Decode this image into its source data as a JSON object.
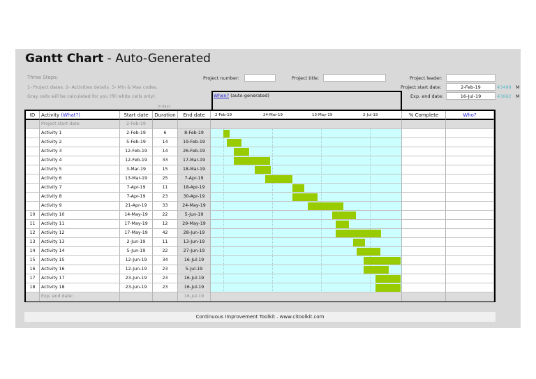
{
  "header": {
    "title_bold": "Gantt Chart",
    "title_rest": " - Auto-Generated",
    "three_steps": "Three Steps:",
    "steps": "1- Project dates.   2- Activities details.   3- Min & Max codes.",
    "note": "Gray cells will be calculated for you (fill white cells only).",
    "project_number_label": "Project number:",
    "project_title_label": "Project title:",
    "project_leader_label": "Project leader:",
    "project_start_label": "Project start date:",
    "project_start_value": "2-Feb-19",
    "project_start_serial": "43498",
    "exp_end_label": "Exp. end date:",
    "exp_end_value": "16-Jul-19",
    "exp_end_serial": "43662",
    "serial_suffix": "M",
    "in_days": "In days",
    "when_label": "When?",
    "when_rest": " (auto-generated)"
  },
  "table": {
    "col_id": "ID",
    "col_activity": "Activity ",
    "col_activity_link": "(What?)",
    "col_start": "Start date",
    "col_duration": "Duration",
    "col_end": "End date",
    "col_complete": "% Complete",
    "col_who": "Who?",
    "start_row_label": "Project start date:",
    "start_row_value": "2-Feb-19",
    "end_row_label": "Exp. end date:",
    "end_row_value": "16-Jul-19",
    "timeline_ticks": [
      "2-Feb-19",
      "24-Mar-19",
      "13-May-19",
      "2-Jul-19"
    ],
    "rows": [
      {
        "id": "",
        "activity": "Activity 1",
        "start": "2-Feb-19",
        "duration": "6",
        "end": "8-Feb-19",
        "s": 0,
        "d": 6
      },
      {
        "id": "",
        "activity": "Activity 2",
        "start": "5-Feb-19",
        "duration": "14",
        "end": "19-Feb-19",
        "s": 3,
        "d": 14
      },
      {
        "id": "",
        "activity": "Activity 3",
        "start": "12-Feb-19",
        "duration": "14",
        "end": "26-Feb-19",
        "s": 10,
        "d": 14
      },
      {
        "id": "",
        "activity": "Activity 4",
        "start": "12-Feb-19",
        "duration": "33",
        "end": "17-Mar-19",
        "s": 10,
        "d": 33
      },
      {
        "id": "",
        "activity": "Activity 5",
        "start": "3-Mar-19",
        "duration": "15",
        "end": "18-Mar-19",
        "s": 29,
        "d": 15
      },
      {
        "id": "",
        "activity": "Activity 6",
        "start": "13-Mar-19",
        "duration": "25",
        "end": "7-Apr-19",
        "s": 39,
        "d": 25
      },
      {
        "id": "",
        "activity": "Activity 7",
        "start": "7-Apr-19",
        "duration": "11",
        "end": "18-Apr-19",
        "s": 64,
        "d": 11
      },
      {
        "id": "",
        "activity": "Activity 8",
        "start": "7-Apr-19",
        "duration": "23",
        "end": "30-Apr-19",
        "s": 64,
        "d": 23
      },
      {
        "id": "",
        "activity": "Activity 9",
        "start": "21-Apr-19",
        "duration": "33",
        "end": "24-May-19",
        "s": 78,
        "d": 33
      },
      {
        "id": "10",
        "activity": "Activity 10",
        "start": "14-May-19",
        "duration": "22",
        "end": "5-Jun-19",
        "s": 101,
        "d": 22
      },
      {
        "id": "11",
        "activity": "Activity 11",
        "start": "17-May-19",
        "duration": "12",
        "end": "29-May-19",
        "s": 104,
        "d": 12
      },
      {
        "id": "12",
        "activity": "Activity 12",
        "start": "17-May-19",
        "duration": "42",
        "end": "28-Jun-19",
        "s": 104,
        "d": 42
      },
      {
        "id": "13",
        "activity": "Activity 13",
        "start": "2-Jun-19",
        "duration": "11",
        "end": "13-Jun-19",
        "s": 120,
        "d": 11
      },
      {
        "id": "14",
        "activity": "Activity 14",
        "start": "5-Jun-19",
        "duration": "22",
        "end": "27-Jun-19",
        "s": 123,
        "d": 22
      },
      {
        "id": "15",
        "activity": "Activity 15",
        "start": "12-Jun-19",
        "duration": "34",
        "end": "16-Jul-19",
        "s": 130,
        "d": 34
      },
      {
        "id": "16",
        "activity": "Activity 16",
        "start": "12-Jun-19",
        "duration": "23",
        "end": "5-Jul-19",
        "s": 130,
        "d": 23
      },
      {
        "id": "17",
        "activity": "Activity 17",
        "start": "23-Jun-19",
        "duration": "23",
        "end": "16-Jul-19",
        "s": 141,
        "d": 23
      },
      {
        "id": "18",
        "activity": "Activity 18",
        "start": "23-Jun-19",
        "duration": "23",
        "end": "16-Jul-19",
        "s": 141,
        "d": 23
      }
    ]
  },
  "colors": {
    "bar": "#99cc00",
    "timeline_bg": "#ccffff",
    "link": "#1f1fd6",
    "serial": "#5bb8c8"
  },
  "footer": "Continuous Improvement Toolkit . www.citoolkit.com"
}
